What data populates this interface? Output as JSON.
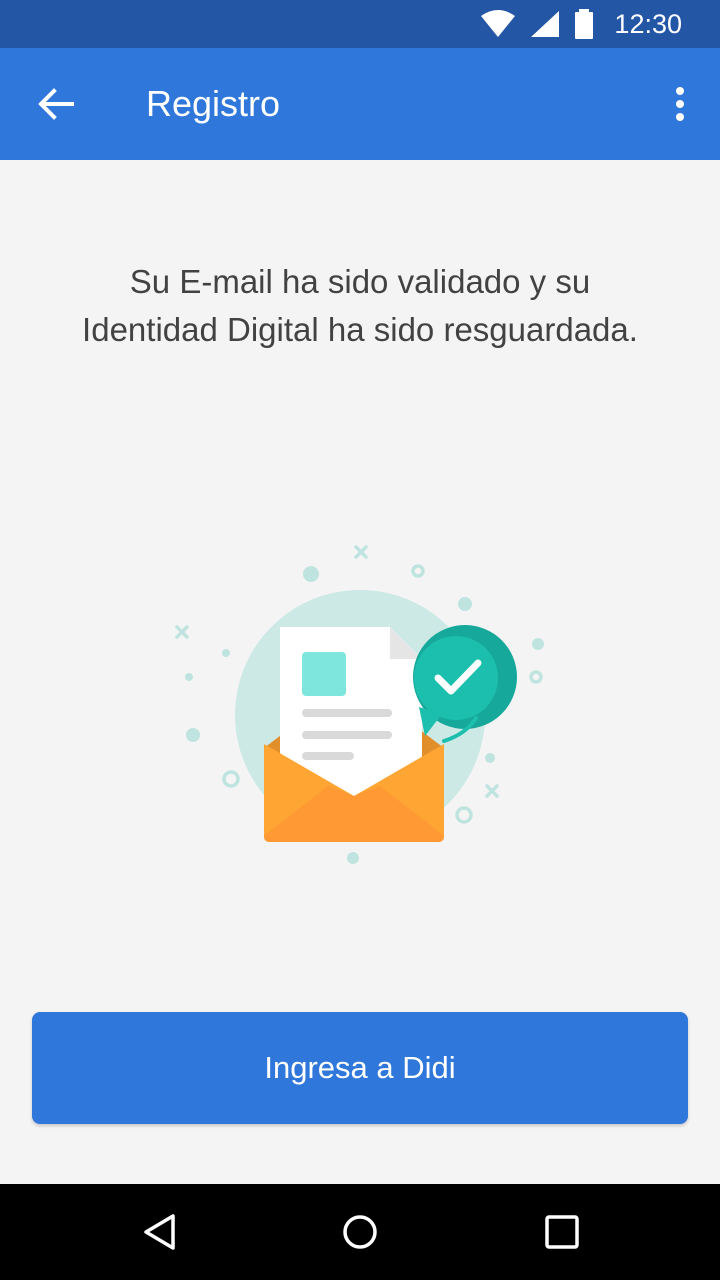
{
  "status_bar": {
    "time": "12:30",
    "icons": [
      "wifi-icon",
      "signal-icon",
      "battery-icon"
    ]
  },
  "app_bar": {
    "title": "Registro",
    "back_icon": "arrow-back-icon",
    "menu_icon": "more-vert-icon"
  },
  "message": "Su E-mail ha sido validado y su Identidad Digital ha sido resguardada.",
  "illustration": {
    "description_icon": "email-validated-icon"
  },
  "cta": {
    "label": "Ingresa a Didi"
  },
  "nav_bar": {
    "icons": [
      "back-triangle-icon",
      "home-circle-icon",
      "recents-square-icon"
    ]
  },
  "colors": {
    "status_bar": "#2456a6",
    "app_bar": "#2f77db",
    "background": "#f4f4f4",
    "text": "#424242",
    "accent_teal": "#1cbfad",
    "envelope": "#ffa534"
  }
}
